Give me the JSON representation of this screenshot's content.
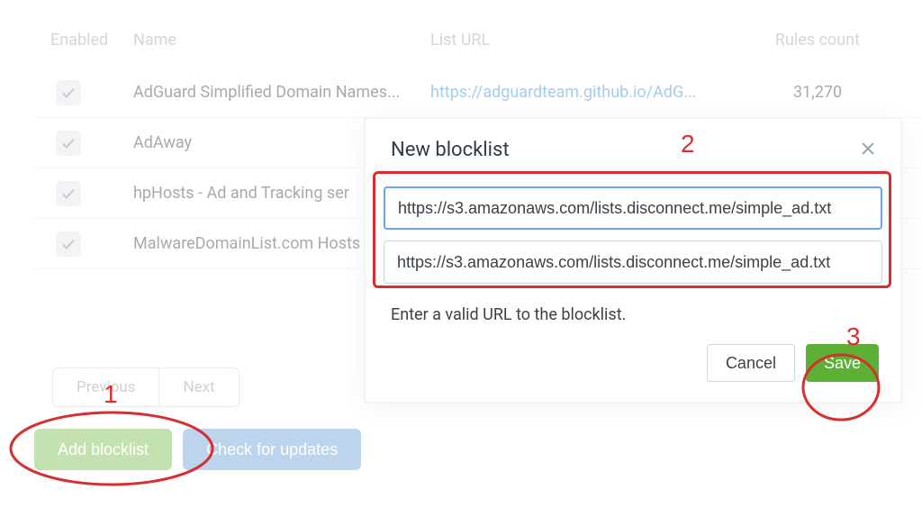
{
  "table": {
    "headers": {
      "enabled": "Enabled",
      "name": "Name",
      "url": "List URL",
      "rules": "Rules count"
    },
    "rows": [
      {
        "name": "AdGuard Simplified Domain Names...",
        "url": "https://adguardteam.github.io/AdG...",
        "rules": "31,270"
      },
      {
        "name": "AdAway",
        "url": "",
        "rules": ""
      },
      {
        "name": "hpHosts - Ad and Tracking ser",
        "url": "",
        "rules": ""
      },
      {
        "name": "MalwareDomainList.com Hosts",
        "url": "",
        "rules": ""
      }
    ]
  },
  "pager": {
    "prev": "Previous",
    "next": "Next"
  },
  "actions": {
    "add": "Add blocklist",
    "check": "Check for updates"
  },
  "modal": {
    "title": "New blocklist",
    "input1": "https://s3.amazonaws.com/lists.disconnect.me/simple_ad.txt",
    "input2": "https://s3.amazonaws.com/lists.disconnect.me/simple_ad.txt",
    "hint": "Enter a valid URL to the blocklist.",
    "cancel": "Cancel",
    "save": "Save"
  },
  "annotations": {
    "n1": "1",
    "n2": "2",
    "n3": "3"
  }
}
